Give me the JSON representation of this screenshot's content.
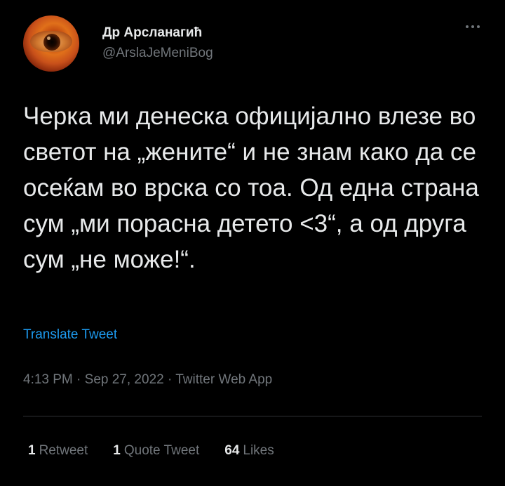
{
  "author": {
    "display_name": "Др Арсланагиħ",
    "handle": "@ArslaJeMeniBog"
  },
  "tweet": {
    "text": "Черка ми денеска официјално влезе во светот на „жените“ и не знам како да се осеќам во врска со тоа. Од една страна сум „ми порасна детето <3“, а од друга сум „не може!“.",
    "translate_label": "Translate Tweet"
  },
  "meta": {
    "time": "4:13 PM",
    "date": "Sep 27, 2022",
    "source": "Twitter Web App",
    "separator": "·"
  },
  "stats": {
    "retweets_count": "1",
    "retweets_label": "Retweet",
    "quotes_count": "1",
    "quotes_label": "Quote Tweet",
    "likes_count": "64",
    "likes_label": "Likes"
  },
  "icons": {
    "more": "more-dots-icon"
  },
  "colors": {
    "background": "#000000",
    "text": "#e7e9ea",
    "secondary": "#71767b",
    "link": "#1d9bf0",
    "divider": "#2f3336"
  }
}
